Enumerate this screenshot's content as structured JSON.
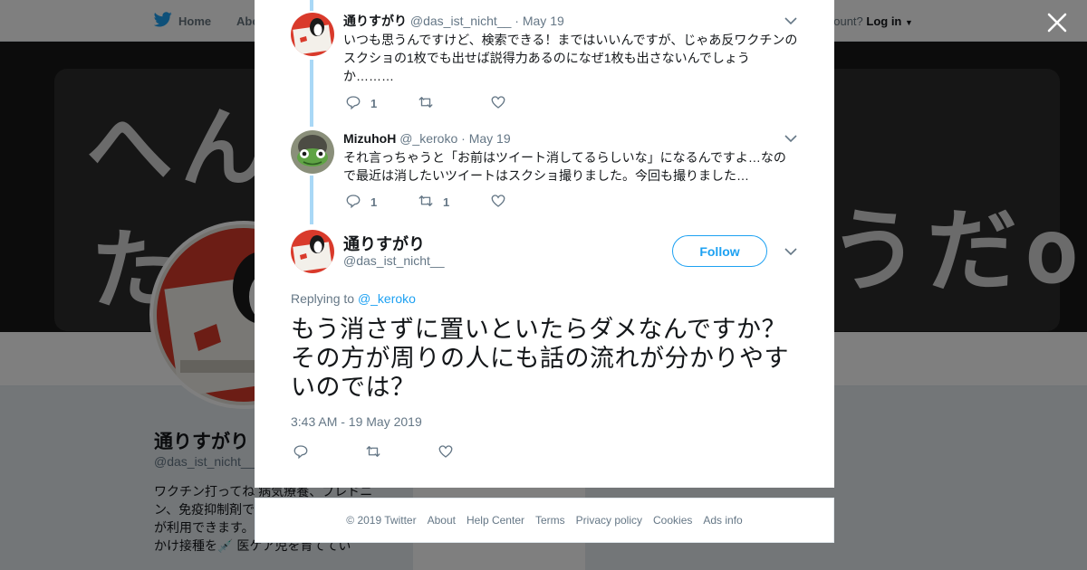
{
  "background": {
    "nav": {
      "home_label": "Home",
      "about_label": "Abo",
      "account_prompt": "account?",
      "login_label": "Log in"
    },
    "banner": {
      "line1": "へん",
      "line2": "たす",
      "line3": "うだo"
    },
    "profile": {
      "name": "通りすがり",
      "handle": "@das_ist_nicht__",
      "bio": "ワクチン打ってね 病気療養、プレドニン、免疫抑制剤で 自治体によっては 制度が利用できます。見解中にワクチン追っかけ接種を💉 医ケア児を育ててい"
    },
    "side_card_text": "Ads info"
  },
  "thread": [
    {
      "name": "通りすがり",
      "handle": "@das_ist_nicht__",
      "date": "May 19",
      "text": "いつも思うんですけど、検索できる！まではいいんですが、じゃあ反ワクチンのスクショの1枚でも出せば説得力あるのになぜ1枚も出さないんでしょうか………",
      "replies": "1",
      "retweets": "",
      "likes": ""
    },
    {
      "name": "MizuhoH",
      "handle": "@_keroko",
      "date": "May 19",
      "text": "それ言っちゃうと「お前はツイート消してるらしいな」になるんですよ…なので最近は消したいツイートはスクショ撮りました。今回も撮りました…",
      "replies": "1",
      "retweets": "1",
      "likes": ""
    }
  ],
  "main_tweet": {
    "name": "通りすがり",
    "handle": "@das_ist_nicht__",
    "follow_label": "Follow",
    "replying_prefix": "Replying to",
    "replying_to": "@_keroko",
    "text": "もう消さずに置いといたらダメなんですか？その方が周りの人にも話の流れが分かりやすいのでは？",
    "timestamp": "3:43 AM - 19 May 2019"
  },
  "footer": {
    "links": [
      "© 2019 Twitter",
      "About",
      "Help Center",
      "Terms",
      "Privacy policy",
      "Cookies",
      "Ads info"
    ]
  },
  "colors": {
    "accent": "#1da1f2",
    "thread_line": "#a9d8f6",
    "muted": "#657786"
  },
  "icons": [
    "twitter-bird-icon",
    "close-icon",
    "chevron-down-icon",
    "reply-icon",
    "retweet-icon",
    "like-icon"
  ]
}
